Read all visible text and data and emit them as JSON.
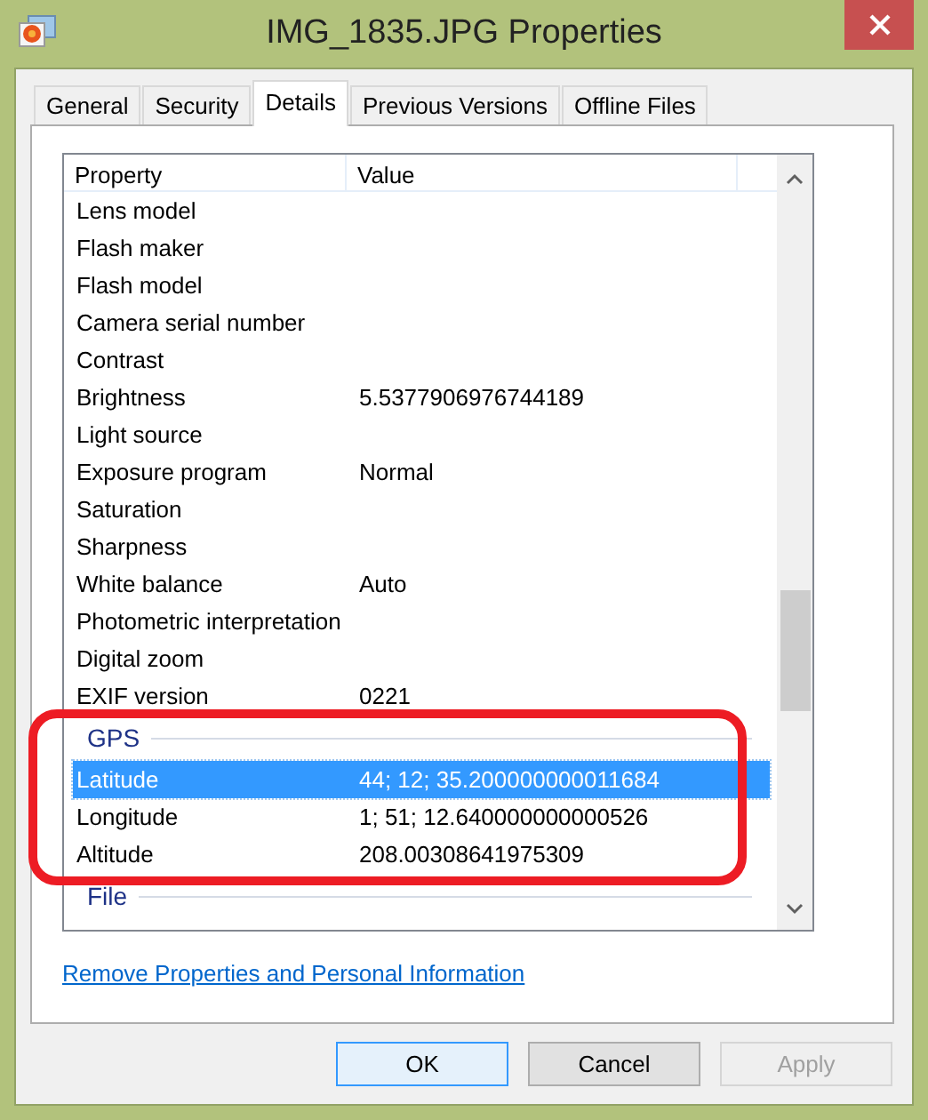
{
  "window": {
    "title": "IMG_1835.JPG Properties"
  },
  "tabs": [
    {
      "label": "General",
      "selected": false
    },
    {
      "label": "Security",
      "selected": false
    },
    {
      "label": "Details",
      "selected": true
    },
    {
      "label": "Previous Versions",
      "selected": false
    },
    {
      "label": "Offline Files",
      "selected": false
    }
  ],
  "details": {
    "columns": [
      "Property",
      "Value"
    ],
    "items": [
      {
        "kind": "row",
        "property": "Lens model",
        "value": "",
        "selected": false
      },
      {
        "kind": "row",
        "property": "Flash maker",
        "value": "",
        "selected": false
      },
      {
        "kind": "row",
        "property": "Flash model",
        "value": "",
        "selected": false
      },
      {
        "kind": "row",
        "property": "Camera serial number",
        "value": "",
        "selected": false
      },
      {
        "kind": "row",
        "property": "Contrast",
        "value": "",
        "selected": false
      },
      {
        "kind": "row",
        "property": "Brightness",
        "value": "5.5377906976744189",
        "selected": false
      },
      {
        "kind": "row",
        "property": "Light source",
        "value": "",
        "selected": false
      },
      {
        "kind": "row",
        "property": "Exposure program",
        "value": "Normal",
        "selected": false
      },
      {
        "kind": "row",
        "property": "Saturation",
        "value": "",
        "selected": false
      },
      {
        "kind": "row",
        "property": "Sharpness",
        "value": "",
        "selected": false
      },
      {
        "kind": "row",
        "property": "White balance",
        "value": "Auto",
        "selected": false
      },
      {
        "kind": "row",
        "property": "Photometric interpretation",
        "value": "",
        "selected": false
      },
      {
        "kind": "row",
        "property": "Digital zoom",
        "value": "",
        "selected": false
      },
      {
        "kind": "row",
        "property": "EXIF version",
        "value": "0221",
        "selected": false
      },
      {
        "kind": "group",
        "label": "GPS"
      },
      {
        "kind": "row",
        "property": "Latitude",
        "value": "44; 12; 35.200000000011684",
        "selected": true
      },
      {
        "kind": "row",
        "property": "Longitude",
        "value": "1; 51; 12.640000000000526",
        "selected": false
      },
      {
        "kind": "row",
        "property": "Altitude",
        "value": "208.00308641975309",
        "selected": false
      },
      {
        "kind": "group",
        "label": "File"
      }
    ]
  },
  "link": "Remove Properties and Personal Information",
  "buttons": [
    {
      "label": "OK",
      "default": true,
      "disabled": false
    },
    {
      "label": "Cancel",
      "default": false,
      "disabled": false
    },
    {
      "label": "Apply",
      "default": false,
      "disabled": true
    }
  ]
}
